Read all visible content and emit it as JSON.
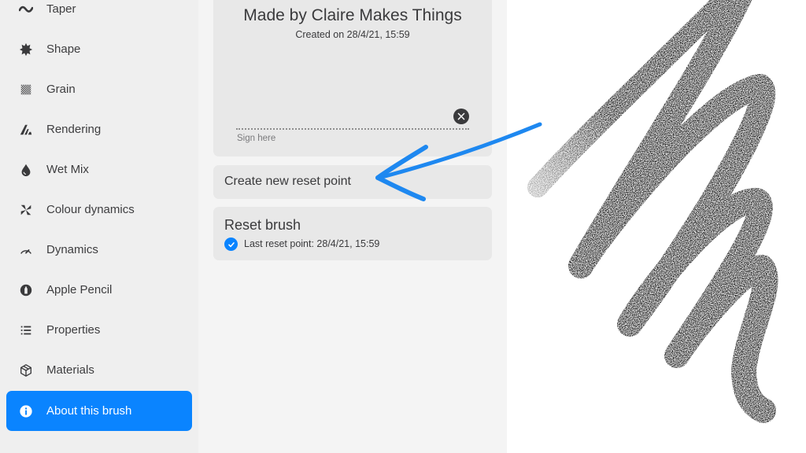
{
  "sidebar": {
    "items": [
      {
        "label": "Taper",
        "icon": "taper-wave-icon"
      },
      {
        "label": "Shape",
        "icon": "shape-starburst-icon"
      },
      {
        "label": "Grain",
        "icon": "grain-checker-icon"
      },
      {
        "label": "Rendering",
        "icon": "rendering-stripes-icon"
      },
      {
        "label": "Wet Mix",
        "icon": "droplet-icon"
      },
      {
        "label": "Colour dynamics",
        "icon": "pinwheel-icon"
      },
      {
        "label": "Dynamics",
        "icon": "speedometer-icon"
      },
      {
        "label": "Apple Pencil",
        "icon": "apple-pencil-icon"
      },
      {
        "label": "Properties",
        "icon": "list-icon"
      },
      {
        "label": "Materials",
        "icon": "cube-icon"
      },
      {
        "label": "About this brush",
        "icon": "info-icon",
        "active": true
      }
    ]
  },
  "about": {
    "author_title": "Made by Claire Makes Things",
    "created": "Created on 28/4/21, 15:59",
    "signature_placeholder": "Sign here",
    "create_reset_point": "Create new reset point",
    "reset_brush": "Reset brush",
    "last_reset_point": "Last reset point: 28/4/21, 15:59"
  },
  "colors": {
    "accent": "#0a84ff",
    "sidebar_bg": "#efefef",
    "panel_bg": "#f4f4f4",
    "card_bg": "#e8e8e8",
    "annotation_arrow": "#1e88f0",
    "stroke": "#000000"
  },
  "annotation": {
    "type": "arrow",
    "points_to": "create-reset-point-button"
  }
}
